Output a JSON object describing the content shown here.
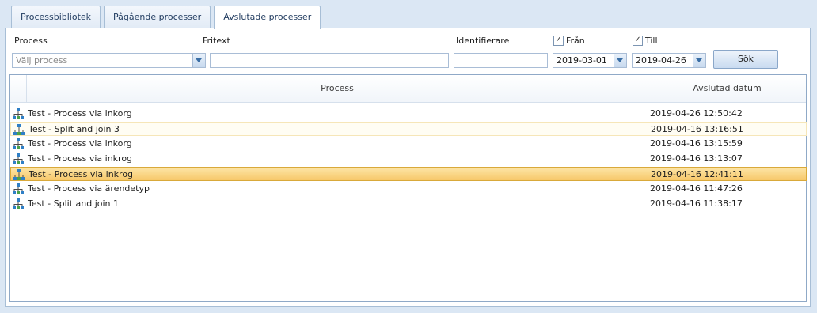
{
  "tabs": [
    {
      "label": "Processbibliotek",
      "active": false
    },
    {
      "label": "Pågående processer",
      "active": false
    },
    {
      "label": "Avslutade processer",
      "active": true
    }
  ],
  "filters": {
    "process_label": "Process",
    "process_placeholder": "Välj process",
    "fritext_label": "Fritext",
    "fritext_value": "",
    "identifierare_label": "Identifierare",
    "identifierare_value": "",
    "fran_label": "Från",
    "fran_checked": true,
    "fran_value": "2019-03-01",
    "till_label": "Till",
    "till_checked": true,
    "till_value": "2019-04-26",
    "search_button": "Sök"
  },
  "grid": {
    "columns": [
      "Process",
      "Avslutad datum"
    ],
    "rows": [
      {
        "icon": "process-tree-icon",
        "name": "Test - Process via inkorg",
        "date": "2019-04-26 12:50:42",
        "state": "normal"
      },
      {
        "icon": "process-tree-icon",
        "name": "Test - Split and join 3",
        "date": "2019-04-16 13:16:51",
        "state": "hover"
      },
      {
        "icon": "process-tree-icon",
        "name": "Test - Process via inkorg",
        "date": "2019-04-16 13:15:59",
        "state": "normal"
      },
      {
        "icon": "process-tree-icon",
        "name": "Test - Process via inkrog",
        "date": "2019-04-16 13:13:07",
        "state": "normal"
      },
      {
        "icon": "process-tree-icon",
        "name": "Test - Process via inkrog",
        "date": "2019-04-16 12:41:11",
        "state": "selected"
      },
      {
        "icon": "process-tree-icon",
        "name": "Test - Process via ärendetyp",
        "date": "2019-04-16 11:47:26",
        "state": "normal"
      },
      {
        "icon": "process-tree-icon",
        "name": "Test - Split and join 1",
        "date": "2019-04-16 11:38:17",
        "state": "normal"
      }
    ]
  },
  "colors": {
    "background": "#dbe7f4",
    "selected_row": "#f7c86a",
    "hover_row": "#fffdf3",
    "icon_blue": "#2f7fc6",
    "icon_green": "#4aa24a"
  }
}
